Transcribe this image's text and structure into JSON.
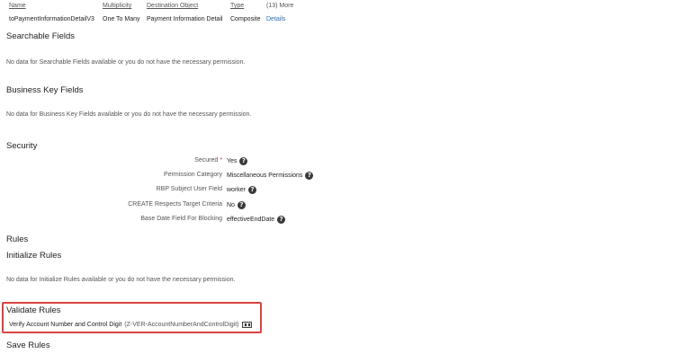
{
  "association_table": {
    "headers": {
      "name": "Name",
      "multiplicity": "Multiplicity",
      "destination": "Destination Object",
      "type": "Type",
      "more": "(13) More"
    },
    "row": {
      "name": "toPaymentInformationDetailV3",
      "multiplicity": "One To Many",
      "destination": "Payment Information Detail",
      "type": "Composite",
      "details_link": "Details"
    }
  },
  "searchable_fields": {
    "title": "Searchable Fields",
    "nodata": "No data for Searchable Fields available or you do not have the necessary permission."
  },
  "business_key_fields": {
    "title": "Business Key Fields",
    "nodata": "No data for Business Key Fields available or you do not have the necessary permission."
  },
  "security": {
    "title": "Security",
    "fields": [
      {
        "label": "Secured",
        "required": "*",
        "value": "Yes"
      },
      {
        "label": "Permission Category",
        "value": "Miscellaneous Permissions"
      },
      {
        "label": "RBP Subject User Field",
        "value": "worker"
      },
      {
        "label": "CREATE Respects Target Criteria",
        "value": "No"
      },
      {
        "label": "Base Date Field For Blocking",
        "value": "effectiveEndDate"
      }
    ]
  },
  "rules": {
    "title": "Rules",
    "initialize_title": "Initialize Rules",
    "initialize_nodata": "No data for Initialize Rules available or you do not have the necessary permission.",
    "validate_title": "Validate Rules",
    "validate_rule_name": "Verify Account Number and Control Digit",
    "validate_rule_code": "(Z-VER-AccountNumberAndControlDigit)",
    "save_title": "Save Rules"
  },
  "icons": {
    "help": "question-circle-icon",
    "rule": "rule-edit-icon"
  },
  "colors": {
    "link": "#2a6ebb",
    "highlight_border": "#d9443f",
    "help_icon_bg": "#3a3a3a"
  }
}
